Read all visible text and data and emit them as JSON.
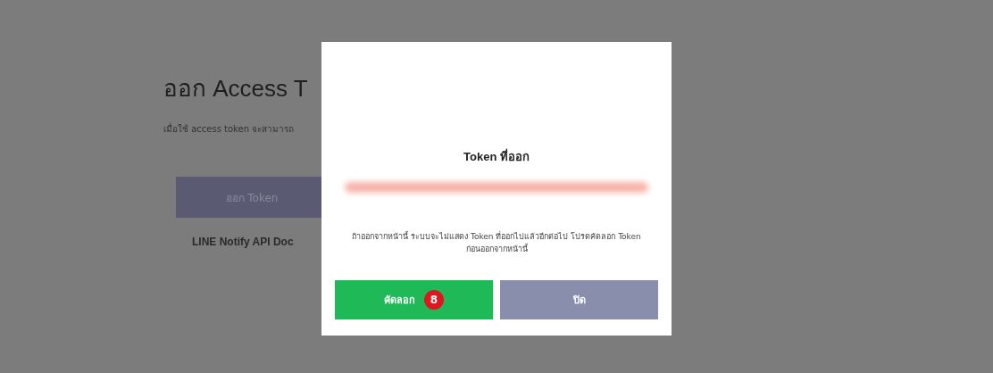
{
  "page": {
    "heading": "ออก Access T",
    "description": "เมื่อใช้ access token จะสามารถ",
    "issue_button": "ออก Token",
    "docs_link": "LINE Notify API Doc"
  },
  "dialog": {
    "title": "Token ที่ออก",
    "message": "ถ้าออกจากหน้านี้ ระบบจะไม่แสดง Token ที่ออกไปแล้วอีกต่อไป โปรดคัดลอก Token ก่อนออกจากหน้านี้",
    "buttons": [
      {
        "kind": "primary",
        "label": "คัดลอก",
        "badge": "8"
      },
      {
        "kind": "secondary",
        "label": "ปิด"
      }
    ]
  }
}
